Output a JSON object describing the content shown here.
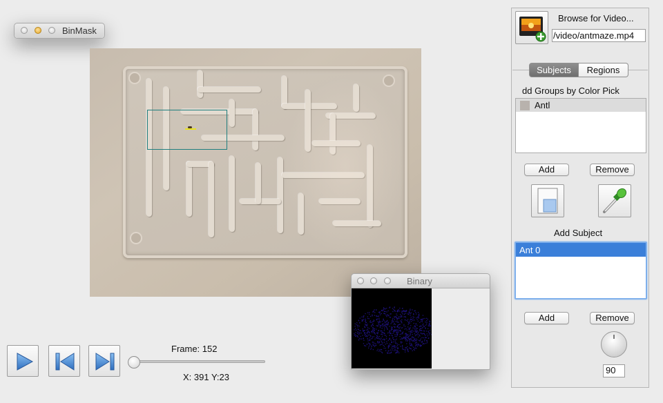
{
  "main_window": {
    "title": "BinMask"
  },
  "playback": {
    "frame_label": "Frame: 152",
    "coords_label": "X: 391 Y:23",
    "slider_position": 0.02
  },
  "binary_window": {
    "title": "Binary"
  },
  "panel": {
    "browse_label": "Browse for Video...",
    "video_path": "/video/antmaze.mp4",
    "tabs": [
      {
        "label": "Subjects",
        "active": true
      },
      {
        "label": "Regions",
        "active": false
      }
    ],
    "groups_heading": "dd Groups by Color Pick",
    "groups": [
      {
        "label": "Antl",
        "swatch": "#b8b2ad"
      }
    ],
    "groups_add": "Add",
    "groups_remove": "Remove",
    "subject_heading": "Add Subject",
    "subjects": [
      {
        "label": "Ant 0",
        "selected": true
      }
    ],
    "subjects_add": "Add",
    "subjects_remove": "Remove",
    "threshold_value": "90"
  },
  "colors": {
    "selection": "#3b7fd9",
    "focus_ring": "#6aa6ec",
    "tracking_box": "#1f7f7f",
    "ant_marker": "#e9e21d",
    "binary_pixels": "#1d1178"
  },
  "icons": {
    "play": "play-icon",
    "previous": "skip-back-icon",
    "next": "skip-forward-icon",
    "browse": "add-video-icon",
    "mask": "mask-rectangle-icon",
    "eyedropper": "eyedropper-icon"
  }
}
